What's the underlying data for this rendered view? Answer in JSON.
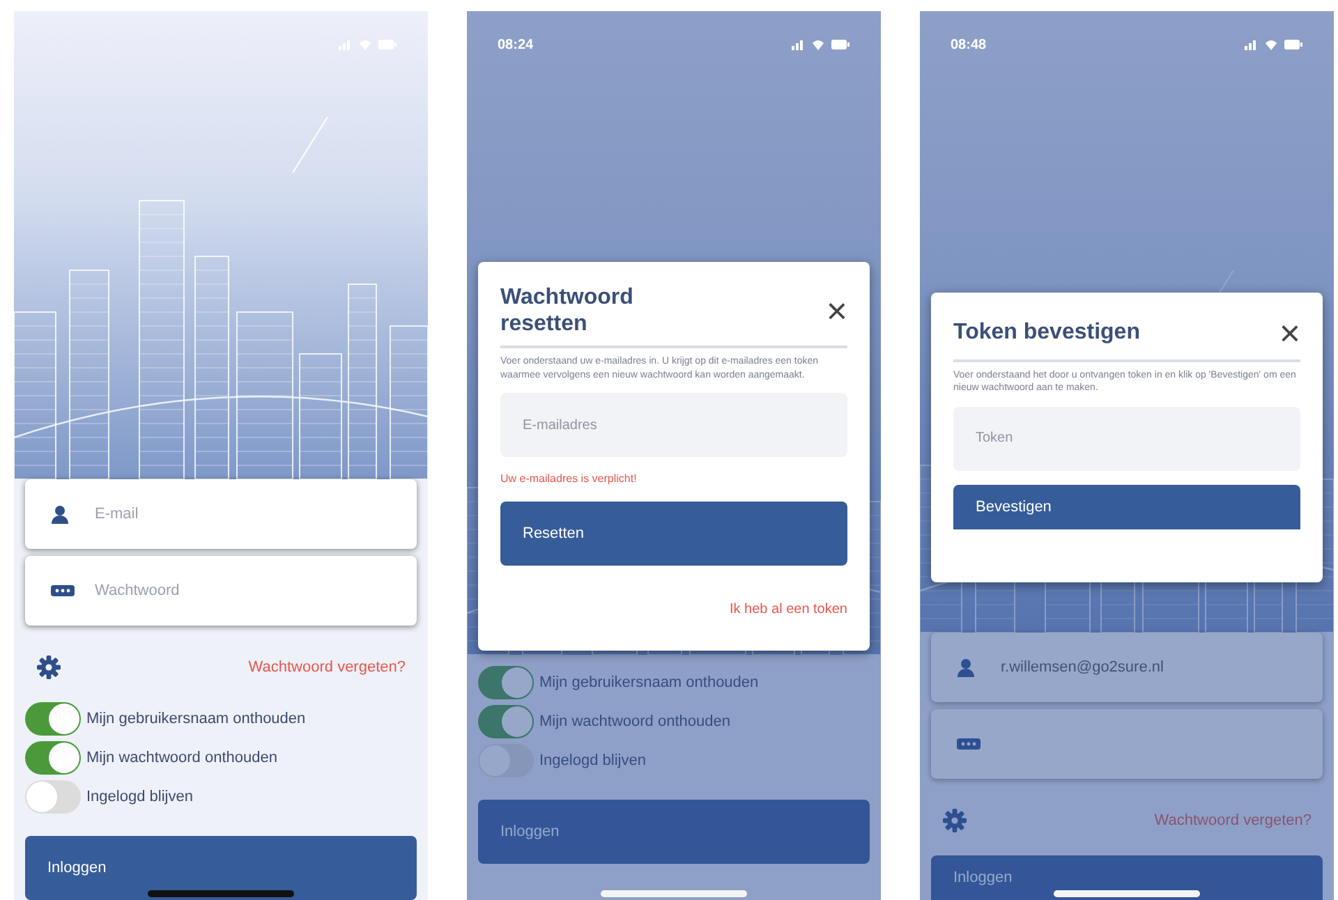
{
  "phones": [
    {
      "dimmed": false,
      "form": {
        "fields": [
          {
            "kind": "email",
            "placeholder": "E-mail"
          },
          {
            "kind": "password",
            "placeholder": "Wachtwoord"
          }
        ],
        "forgot_link": "Wachtwoord vergeten?",
        "toggles": [
          {
            "label": "Mijn gebruikersnaam onthouden",
            "on": true
          },
          {
            "label": "Mijn wachtwoord onthouden",
            "on": true
          },
          {
            "label": "Ingelogd blijven",
            "on": false
          }
        ],
        "login_button": "Inloggen"
      }
    },
    {
      "status_time": "08:24",
      "dimmed": true,
      "form": {
        "toggles": [
          {
            "label": "Mijn gebruikersnaam onthouden",
            "on": true
          },
          {
            "label": "Mijn wachtwoord onthouden",
            "on": true
          },
          {
            "label": "Ingelogd blijven",
            "on": false
          }
        ],
        "login_button": "Inloggen"
      },
      "modal": {
        "title": "Wachtwoord resetten",
        "description": "Voer onderstaand uw e-mailadres in. U krijgt op dit e-mailadres een token waarmee vervolgens een nieuw wachtwoord kan worden aangemaakt.",
        "field": {
          "placeholder": "E-mailadres"
        },
        "error": "Uw e-mailadres is verplicht!",
        "button": "Resetten",
        "link": "Ik heb al een token",
        "close": "×"
      }
    },
    {
      "status_time": "08:48",
      "dimmed": true,
      "form": {
        "fields": [
          {
            "kind": "email",
            "value": "r.willemsen@go2sure.nl"
          },
          {
            "kind": "password"
          }
        ],
        "forgot_link": "Wachtwoord vergeten?",
        "login_button": "Inloggen"
      },
      "modal": {
        "title": "Token bevestigen",
        "description": "Voer onderstaand het door u ontvangen token in en klik op 'Bevestigen' om een nieuw wachtwoord aan te maken.",
        "field": {
          "placeholder": "Token"
        },
        "button": "Bevestigen",
        "close": "×"
      }
    }
  ]
}
